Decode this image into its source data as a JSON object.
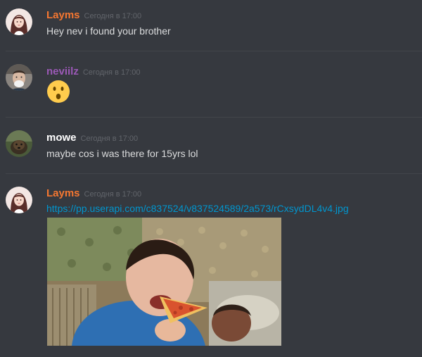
{
  "messages": [
    {
      "username": "Layms",
      "username_color": "#f57731",
      "timestamp": "Сегодня в 17:00",
      "text": "Hey nev i found your brother"
    },
    {
      "username": "neviilz",
      "username_color": "#9b59b6",
      "timestamp": "Сегодня в 17:00",
      "emoji": "hushed-face"
    },
    {
      "username": "mowe",
      "username_color": "#ffffff",
      "timestamp": "Сегодня в 17:00",
      "text": "maybe cos i was there for 15yrs lol"
    },
    {
      "username": "Layms",
      "username_color": "#f57731",
      "timestamp": "Сегодня в 17:00",
      "link": "https://pp.userapi.com/c837524/v837524589/2a573/rCxsydDL4v4.jpg",
      "attachment": "photo of a person eating a slice of pizza"
    }
  ],
  "theme": {
    "background": "#36393f",
    "text": "#dcddde",
    "timestamp": "#62656b",
    "link": "#0096cf"
  }
}
